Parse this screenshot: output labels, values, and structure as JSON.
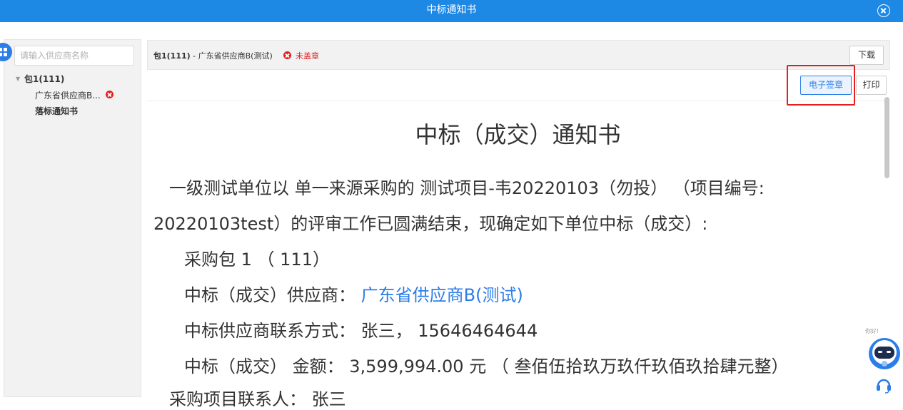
{
  "window": {
    "title": "中标通知书"
  },
  "sidebar": {
    "search_placeholder": "请输入供应商名称",
    "tree": {
      "package": "包1(111)",
      "supplier": "广东省供应商B...",
      "notice": "落标通知书"
    }
  },
  "header": {
    "package_label": "包1(111)",
    "supplier_label": " - 广东省供应商B(测试)",
    "status": "未盖章",
    "download_label": "下载"
  },
  "toolbar": {
    "sign_label": "电子签章",
    "print_label": "打印"
  },
  "document": {
    "title": "中标（成交）通知书",
    "line1": "一级测试单位以 单一来源采购的 测试项目-韦20220103（勿投）  （项目编号:",
    "line2": "20220103test）的评审工作已圆满结束，现确定如下单位中标（成交）:",
    "line3": "采购包 1 （ 111）",
    "line4_label": "中标（成交）供应商： ",
    "line4_value": "广东省供应商B(测试)",
    "line5": "中标供应商联系方式： 张三， 15646464644",
    "line6": "中标（成交） 金额： 3,599,994.00 元 （ 叁佰伍拾玖万玖仟玖佰玖拾肆元整）",
    "line7": "采购项目联系人： 张三"
  },
  "assistant": {
    "greeting": "你好!"
  },
  "colors": {
    "titlebar": "#1e88e5",
    "accent": "#2b7de9",
    "error": "#e02020",
    "highlight": "#e61e1e"
  }
}
